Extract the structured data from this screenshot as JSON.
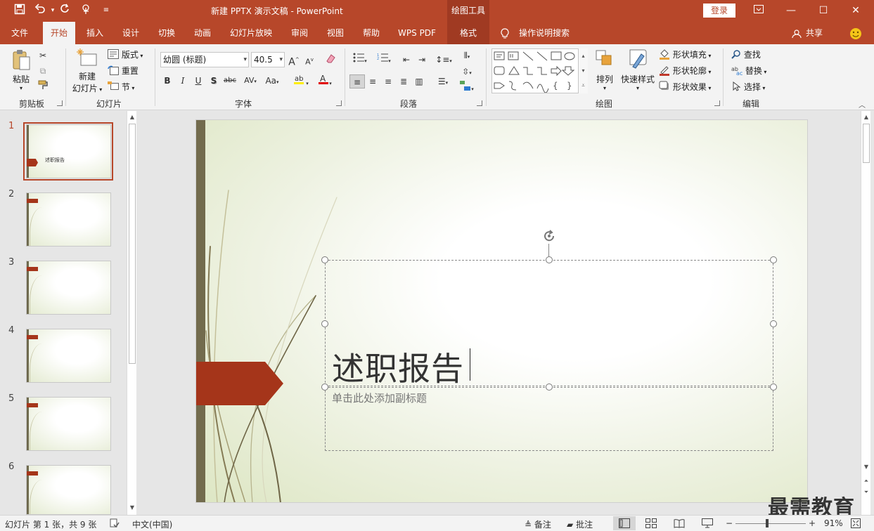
{
  "titlebar": {
    "title": "新建 PPTX 演示文稿  -  PowerPoint",
    "tool_header": "绘图工具",
    "login": "登录",
    "qa_icons": [
      "save-icon",
      "undo-icon",
      "redo-icon",
      "touch-mode-icon",
      "customize-qa-icon"
    ]
  },
  "tabs": [
    {
      "label": "文件",
      "active": false
    },
    {
      "label": "开始",
      "active": true
    },
    {
      "label": "插入",
      "active": false
    },
    {
      "label": "设计",
      "active": false
    },
    {
      "label": "切换",
      "active": false
    },
    {
      "label": "动画",
      "active": false
    },
    {
      "label": "幻灯片放映",
      "active": false
    },
    {
      "label": "审阅",
      "active": false
    },
    {
      "label": "视图",
      "active": false
    },
    {
      "label": "帮助",
      "active": false
    },
    {
      "label": "WPS PDF",
      "active": false
    },
    {
      "label": "格式",
      "active": false
    }
  ],
  "tellme": "操作说明搜索",
  "share": "共享",
  "ribbon": {
    "clipboard": {
      "label": "剪贴板",
      "paste": "粘贴"
    },
    "slides": {
      "label": "幻灯片",
      "new_slide": "新建",
      "new_slide2": "幻灯片",
      "layout": "版式",
      "reset": "重置",
      "section": "节"
    },
    "font": {
      "label": "字体",
      "font_name": "幼圆 (标题)",
      "font_size": "40.5",
      "case": "Aa"
    },
    "paragraph": {
      "label": "段落"
    },
    "drawing": {
      "label": "绘图",
      "arrange": "排列",
      "quick_styles": "快速样式",
      "shape_fill": "形状填充",
      "shape_outline": "形状轮廓",
      "shape_effects": "形状效果"
    },
    "editing": {
      "label": "编辑",
      "find": "查找",
      "replace": "替换",
      "select": "选择"
    }
  },
  "thumbnails": [
    {
      "num": "1",
      "text": "述职报告",
      "selected": true
    },
    {
      "num": "2",
      "text": "",
      "selected": false
    },
    {
      "num": "3",
      "text": "",
      "selected": false
    },
    {
      "num": "4",
      "text": "",
      "selected": false
    },
    {
      "num": "5",
      "text": "",
      "selected": false
    },
    {
      "num": "6",
      "text": "",
      "selected": false
    }
  ],
  "slide": {
    "title": "述职报告",
    "subtitle": "单击此处添加副标题"
  },
  "status": {
    "slide_info": "幻灯片 第 1 张，共 9 张",
    "language": "中文(中国)",
    "notes": "备注",
    "comments": "批注",
    "zoom": "91%"
  },
  "watermark": "最需教育",
  "colors": {
    "accent": "#b7472a",
    "slide_bar": "#726b4d",
    "arrow": "#a5351a"
  }
}
